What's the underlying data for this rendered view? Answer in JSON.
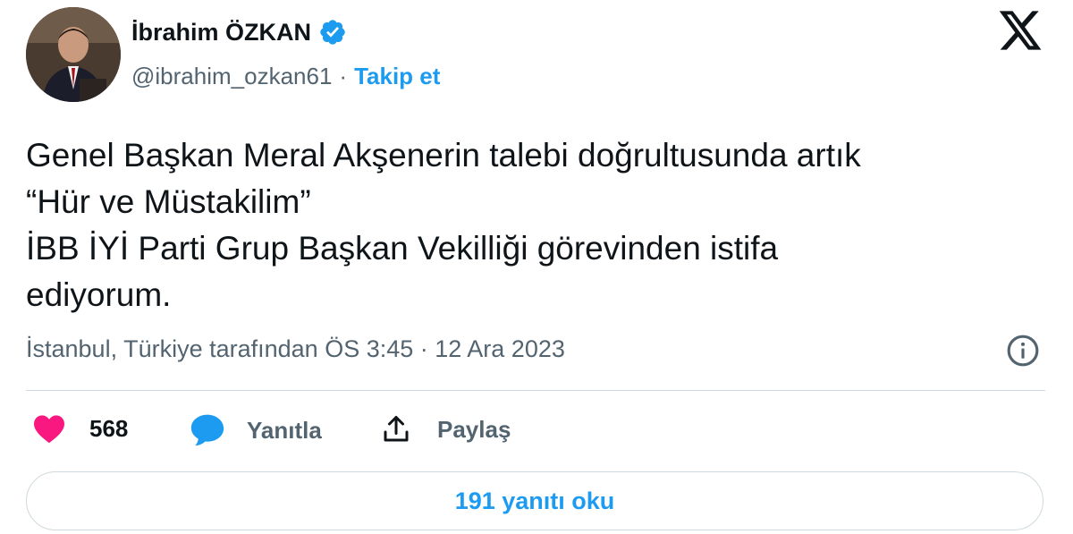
{
  "author": {
    "name": "İbrahim ÖZKAN",
    "handle": "@ibrahim_ozkan61",
    "separator": "·",
    "follow_label": "Takip et"
  },
  "tweet": {
    "lines": [
      "Genel Başkan Meral Akşenerin talebi doğrultusunda artık",
      "“Hür ve Müstakilim”",
      "İBB İYİ Parti Grup Başkan Vekilliği görevinden istifa",
      "ediyorum."
    ],
    "meta": "İstanbul, Türkiye tarafından ÖS 3:45 · 12 Ara 2023"
  },
  "actions": {
    "likes_count": "568",
    "reply_label": "Yanıtla",
    "share_label": "Paylaş"
  },
  "replies_button_label": "191 yanıtı oku",
  "icons": {
    "verified": "verified-badge-icon",
    "x_logo": "x-logo-icon",
    "info": "info-icon",
    "like": "heart-icon",
    "reply": "speech-bubble-icon",
    "share": "share-upload-icon"
  },
  "colors": {
    "accent": "#1d9bf0",
    "like": "#f91880",
    "text_primary": "#0f1419",
    "text_secondary": "#536471",
    "border": "#cfd9de"
  }
}
